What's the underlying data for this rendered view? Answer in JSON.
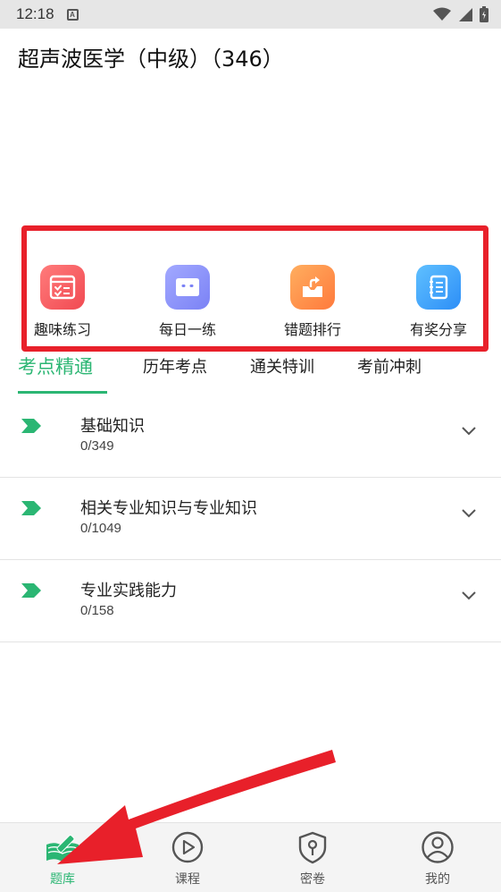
{
  "status_bar": {
    "time": "12:18",
    "notif_letter": "A"
  },
  "header": {
    "title": "超声波医学（中级）（346）"
  },
  "quick_actions": [
    {
      "label": "趣味练习",
      "icon": "checklist-icon",
      "color_start": "#ff7b7b",
      "color_end": "#f14a52"
    },
    {
      "label": "每日一练",
      "icon": "robot-face-icon",
      "color_start": "#a2a9ff",
      "color_end": "#7b82f5"
    },
    {
      "label": "错题排行",
      "icon": "share-box-icon",
      "color_start": "#ffae5f",
      "color_end": "#ff7a3c"
    },
    {
      "label": "有奖分享",
      "icon": "notebook-icon",
      "color_start": "#5fc0ff",
      "color_end": "#2d8ef7"
    }
  ],
  "tabs": [
    {
      "label": "考点精通",
      "active": true
    },
    {
      "label": "历年考点",
      "active": false
    },
    {
      "label": "通关特训",
      "active": false
    },
    {
      "label": "考前冲刺",
      "active": false
    }
  ],
  "chapters": [
    {
      "title": "基础知识",
      "count": "0/349"
    },
    {
      "title": "相关专业知识与专业知识",
      "count": "0/1049"
    },
    {
      "title": "专业实践能力",
      "count": "0/158"
    }
  ],
  "bottom_nav": [
    {
      "label": "题库",
      "icon": "book-pen-icon",
      "active": true
    },
    {
      "label": "课程",
      "icon": "play-circle-icon",
      "active": false
    },
    {
      "label": "密卷",
      "icon": "shield-key-icon",
      "active": false
    },
    {
      "label": "我的",
      "icon": "user-circle-icon",
      "active": false
    }
  ],
  "colors": {
    "accent": "#2bb673",
    "annotation_red": "#e8202a"
  }
}
